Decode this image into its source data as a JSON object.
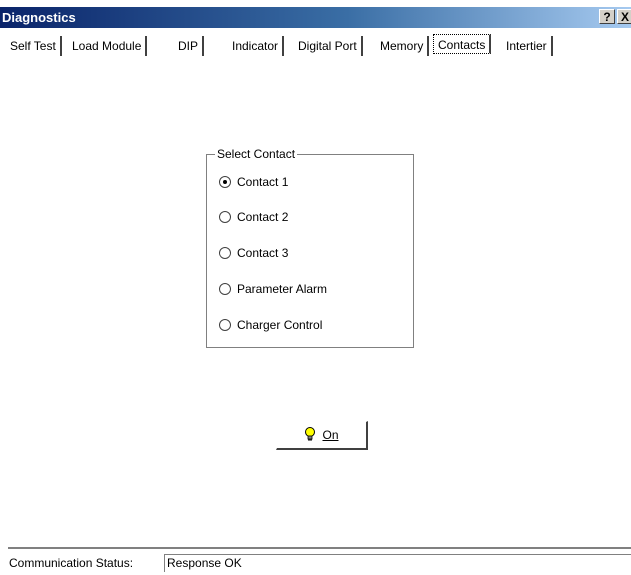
{
  "window": {
    "title": "Diagnostics",
    "help_btn": "?",
    "close_btn": "X"
  },
  "tabs": [
    {
      "label": "Self Test",
      "active": false
    },
    {
      "label": "Load Module",
      "active": false
    },
    {
      "label": "DIP",
      "active": false
    },
    {
      "label": "Indicator",
      "active": false
    },
    {
      "label": "Digital Port",
      "active": false
    },
    {
      "label": "Memory",
      "active": false
    },
    {
      "label": "Contacts",
      "active": true
    },
    {
      "label": "Intertier",
      "active": false
    }
  ],
  "contacts": {
    "group_title": "Select Contact",
    "options": [
      {
        "label": "Contact 1",
        "checked": true
      },
      {
        "label": "Contact 2",
        "checked": false
      },
      {
        "label": "Contact 3",
        "checked": false
      },
      {
        "label": "Parameter Alarm",
        "checked": false
      },
      {
        "label": "Charger Control",
        "checked": false
      }
    ],
    "on_button": "On",
    "bulb_icon": "lightbulb-icon"
  },
  "status": {
    "label": "Communication Status:",
    "value": "Response OK"
  }
}
